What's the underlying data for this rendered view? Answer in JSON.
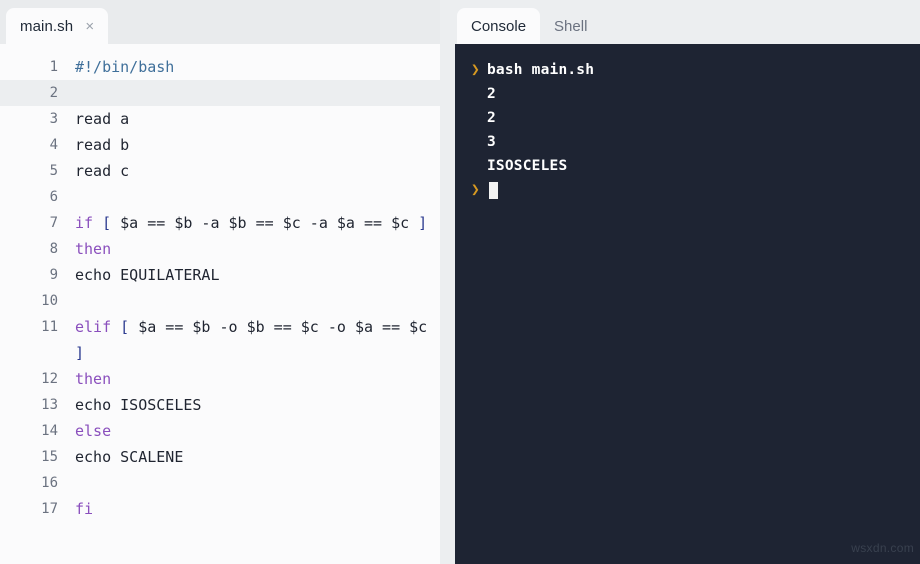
{
  "editor": {
    "tab": {
      "label": "main.sh",
      "close_icon": "close-icon",
      "close_glyph": "×"
    },
    "language": "bash",
    "active_line": 2,
    "lines": [
      {
        "n": "1",
        "tokens": [
          {
            "t": "#!/bin/bash",
            "c": "shebang"
          }
        ]
      },
      {
        "n": "2",
        "tokens": []
      },
      {
        "n": "3",
        "tokens": [
          {
            "t": "read a",
            "c": "plain"
          }
        ]
      },
      {
        "n": "4",
        "tokens": [
          {
            "t": "read b",
            "c": "plain"
          }
        ]
      },
      {
        "n": "5",
        "tokens": [
          {
            "t": "read c",
            "c": "plain"
          }
        ]
      },
      {
        "n": "6",
        "tokens": []
      },
      {
        "n": "7",
        "tokens": [
          {
            "t": "if ",
            "c": "kw"
          },
          {
            "t": "[",
            "c": "bracket"
          },
          {
            "t": " $a == $b -a $b == $c -a $a == $c ",
            "c": "plain"
          },
          {
            "t": "]",
            "c": "bracket"
          }
        ]
      },
      {
        "n": "8",
        "tokens": [
          {
            "t": "then",
            "c": "kw"
          }
        ]
      },
      {
        "n": "9",
        "tokens": [
          {
            "t": "echo EQUILATERAL",
            "c": "plain"
          }
        ]
      },
      {
        "n": "10",
        "tokens": []
      },
      {
        "n": "11",
        "tokens": [
          {
            "t": "elif ",
            "c": "kw"
          },
          {
            "t": "[",
            "c": "bracket"
          },
          {
            "t": " $a == $b -o $b == $c -o $a == $c ",
            "c": "plain"
          },
          {
            "t": "]",
            "c": "bracket"
          }
        ]
      },
      {
        "n": "12",
        "tokens": [
          {
            "t": "then",
            "c": "kw"
          }
        ]
      },
      {
        "n": "13",
        "tokens": [
          {
            "t": "echo ISOSCELES",
            "c": "plain"
          }
        ]
      },
      {
        "n": "14",
        "tokens": [
          {
            "t": "else",
            "c": "kw"
          }
        ]
      },
      {
        "n": "15",
        "tokens": [
          {
            "t": "echo SCALENE",
            "c": "plain"
          }
        ]
      },
      {
        "n": "16",
        "tokens": []
      },
      {
        "n": "17",
        "tokens": [
          {
            "t": "fi",
            "c": "kw"
          }
        ]
      }
    ],
    "scrollbar": {
      "name": "editor-vertical-scrollbar"
    }
  },
  "console": {
    "tabs": [
      {
        "label": "Console",
        "active": true
      },
      {
        "label": "Shell",
        "active": false
      }
    ],
    "prompt_glyph": "❯",
    "lines": [
      {
        "prompt": true,
        "text": "bash main.sh",
        "cursor": false
      },
      {
        "prompt": false,
        "text": "2",
        "cursor": false
      },
      {
        "prompt": false,
        "text": "2",
        "cursor": false
      },
      {
        "prompt": false,
        "text": "3",
        "cursor": false
      },
      {
        "prompt": false,
        "text": "ISOSCELES",
        "cursor": false
      },
      {
        "prompt": true,
        "text": "",
        "cursor": true
      }
    ]
  },
  "watermark": {
    "text": "wsxdn.com"
  },
  "colors": {
    "editor_bg": "#fbfbfc",
    "chrome_bg": "#e9ebed",
    "terminal_bg": "#1e2433",
    "keyword": "#8a4fbd",
    "shebang": "#3f6f9a",
    "bracket": "#2b3a8f",
    "prompt": "#d79921"
  }
}
